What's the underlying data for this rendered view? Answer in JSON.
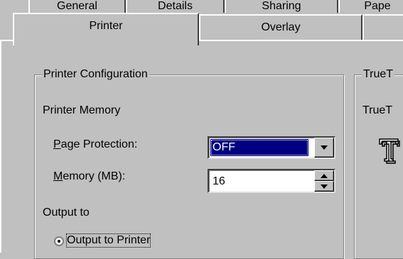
{
  "tabs_row1": [
    {
      "label": "General"
    },
    {
      "label": "Details"
    },
    {
      "label": "Sharing"
    },
    {
      "label": "Pape"
    }
  ],
  "tabs_row2": [
    {
      "label": "Printer",
      "active": true
    },
    {
      "label": "Overlay",
      "active": false
    },
    {
      "label": "",
      "active": false
    }
  ],
  "printer_config": {
    "legend": "Printer Configuration",
    "memory_heading": "Printer Memory",
    "page_protection": {
      "label_prefix": "",
      "label_accel": "P",
      "label_rest": "age Protection:",
      "value": "OFF"
    },
    "memory": {
      "label_accel": "M",
      "label_rest": "emory (MB):",
      "value": "16"
    },
    "output_heading": "Output to",
    "output_option": "Output to Printer"
  },
  "truetype": {
    "legend": "TrueT",
    "label": "TrueT",
    "icon": "truetype-font-icon"
  }
}
